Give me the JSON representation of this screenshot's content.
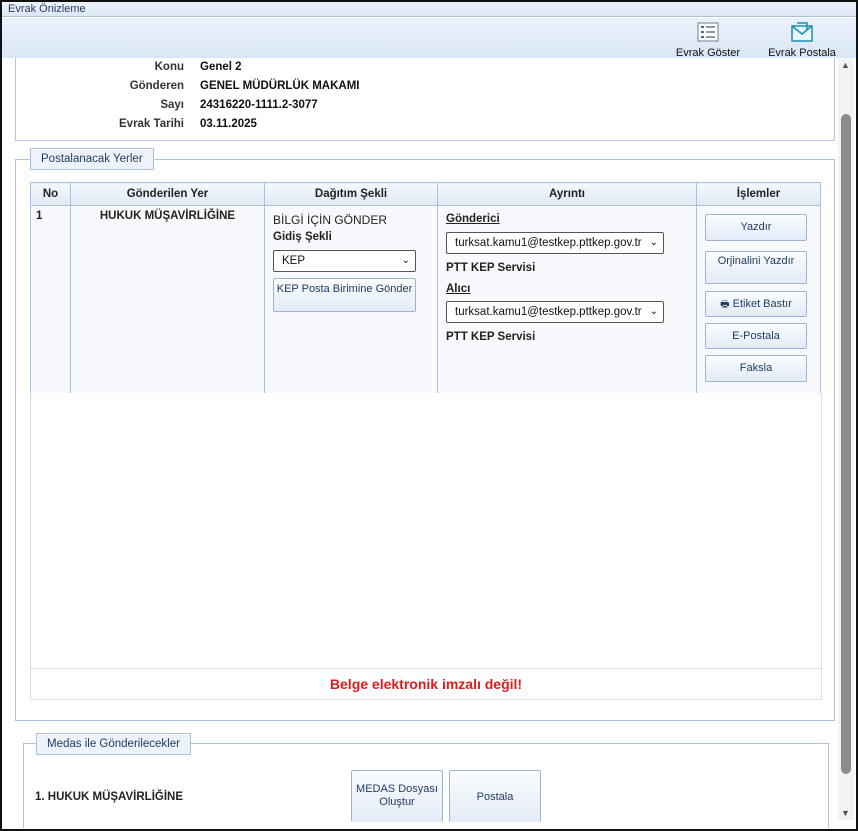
{
  "window": {
    "title": "Evrak Önizleme"
  },
  "toolbar": {
    "show_label": "Evrak Göster",
    "mail_label": "Evrak Postala"
  },
  "info": {
    "rows": [
      {
        "key": "Konu",
        "value": "Genel 2"
      },
      {
        "key": "Gönderen",
        "value": "GENEL MÜDÜRLÜK MAKAMI"
      },
      {
        "key": "Sayı",
        "value": "24316220-1111.2-3077"
      },
      {
        "key": "Evrak Tarihi",
        "value": "03.11.2025"
      }
    ]
  },
  "postal": {
    "legend": "Postalanacak Yerler",
    "columns": [
      "No",
      "Gönderilen Yer",
      "Dağıtım Şekli",
      "Ayrıntı",
      "İşlemler"
    ],
    "row": {
      "no": "1",
      "place": "HUKUK MÜŞAVİRLİĞİNE",
      "distribution": "BİLGİ İÇİN GÖNDER",
      "method_label": "Gidiş Şekli",
      "method_value": "KEP",
      "kep_button": "KEP Posta Birimine Gönder",
      "sender_label": "Gönderici",
      "sender_value": "turksat.kamu1@testkep.pttkep.gov.tr",
      "sender_service": "PTT KEP Servisi",
      "receiver_label": "Alıcı",
      "receiver_value": "turksat.kamu1@testkep.pttkep.gov.tr",
      "receiver_service": "PTT KEP Servisi",
      "actions": {
        "print": "Yazdır",
        "print_original": "Orjinalini Yazdır",
        "label_print": "Etiket Bastır",
        "email": "E-Postala",
        "fax": "Faksla"
      }
    },
    "warning": "Belge elektronik imzalı değil!"
  },
  "medas": {
    "legend": "Medas ile Gönderilecekler",
    "item": "1. HUKUK MÜŞAVİRLİĞİNE",
    "create_button": "MEDAS Dosyası Oluştur",
    "mail_button": "Postala"
  }
}
